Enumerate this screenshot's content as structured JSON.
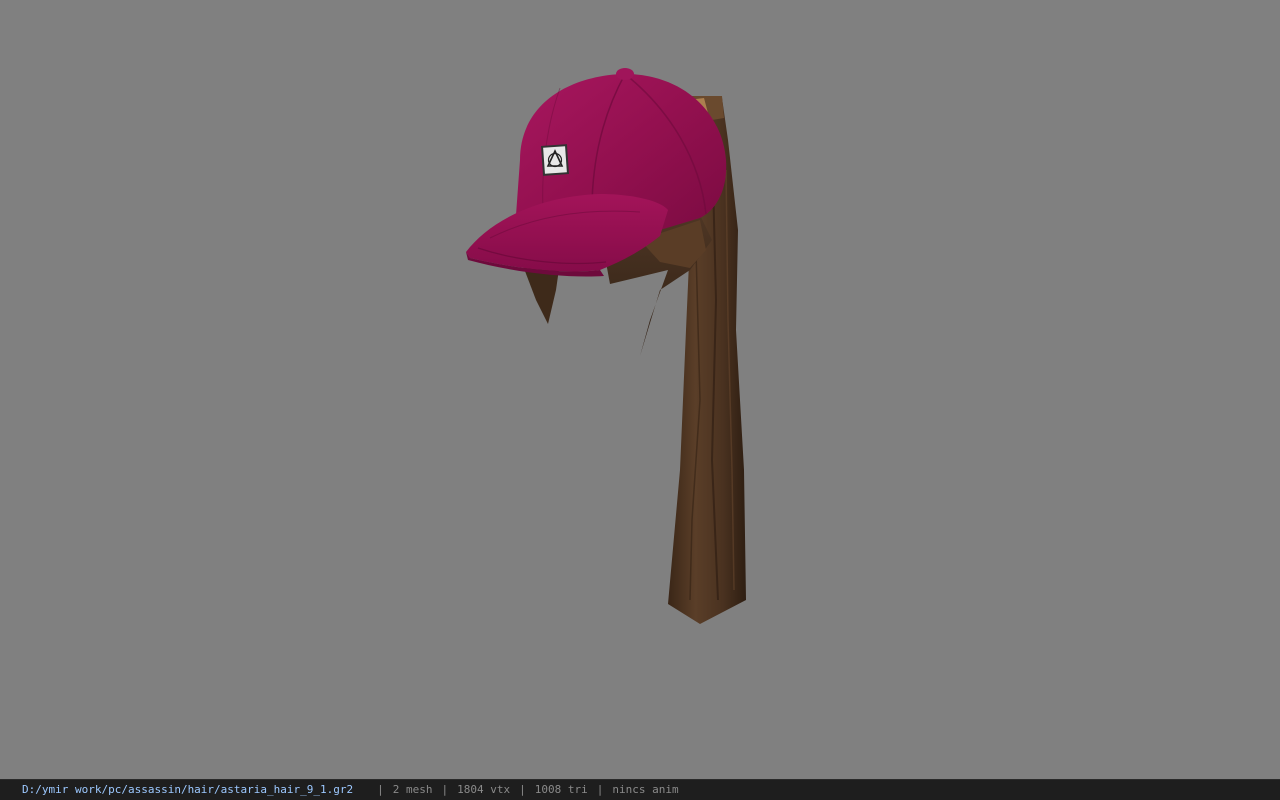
{
  "status_bar": {
    "file_path": "D:/ymir work/pc/assassin/hair/astaria_hair_9_1.gr2",
    "separator": "|",
    "mesh_count": "2 mesh",
    "vertex_count": "1804 vtx",
    "triangle_count": "1008 tri",
    "animation": "nincs anim"
  },
  "colors": {
    "background": "#808080",
    "status_bar_bg": "#1e1e1e",
    "path_text": "#9cc8ff",
    "stat_text": "#8a8a8a",
    "cap_color": "#9a0f55",
    "hair_color": "#4a3322"
  },
  "model": {
    "description_icon": "hair-with-cap-model"
  }
}
